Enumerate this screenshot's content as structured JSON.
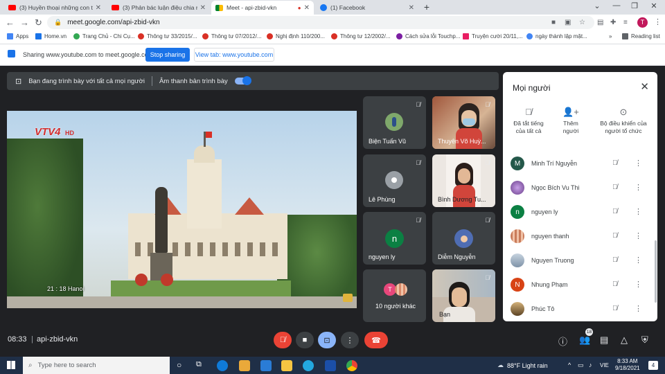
{
  "tabs": [
    {
      "title": "(3) Huyền thoại những con tàu k",
      "icon": "youtube-icon"
    },
    {
      "title": "(3) Phản bác luận điệu chia r",
      "icon": "youtube-icon"
    },
    {
      "title": "Meet - api-zbid-vkn",
      "icon": "meet-icon"
    },
    {
      "title": "(1) Facebook",
      "icon": "facebook-icon"
    }
  ],
  "address": {
    "url": "meet.google.com/api-zbid-vkn"
  },
  "profile_initial": "T",
  "bookmarks": [
    {
      "label": "Apps",
      "color": "#4285f4"
    },
    {
      "label": "Home.vn",
      "color": "#1a73e8"
    },
    {
      "label": "Trang Chủ - Chi Cụ...",
      "color": "#34a853"
    },
    {
      "label": "Thông tư 33/2015/...",
      "color": "#d93025"
    },
    {
      "label": "Thông tư 07/2012/...",
      "color": "#d93025"
    },
    {
      "label": "Nghị định 110/200...",
      "color": "#d93025"
    },
    {
      "label": "Thông tư 12/2002/...",
      "color": "#d93025"
    },
    {
      "label": "Cách sửa lỗi Touchp...",
      "color": "#7b1fa2"
    },
    {
      "label": "Truyện cười 20/11,...",
      "color": "#e91e63"
    },
    {
      "label": "ngày thành lập mặt...",
      "color": "#4285f4"
    },
    {
      "label": "»",
      "color": ""
    },
    {
      "label": "Reading list",
      "color": "#5f6368"
    }
  ],
  "sharing": {
    "text": "Sharing www.youtube.com to meet.google.com",
    "stop_label": "Stop sharing",
    "view_label": "View tab: www.youtube.com"
  },
  "presenting": {
    "text": "Bạn đang trình bày với tất cả mọi người",
    "audio_label": "Âm thanh bản trình bày",
    "audio_on": true
  },
  "video": {
    "channel": "VTV4",
    "hd": "HD",
    "time": "21 : 18 Hanoi"
  },
  "participants": [
    {
      "name": "Biện Tuấn Vũ",
      "avatar": "photo",
      "avatar_color": "#7fa86b",
      "muted": true
    },
    {
      "name": "Thuyên Võ Huỳ...",
      "avatar": "video",
      "muted": true
    },
    {
      "name": "Lê Phùng",
      "avatar": "photo",
      "avatar_color": "#9aa0a6",
      "muted": true
    },
    {
      "name": "Bình Dương Tu...",
      "avatar": "video",
      "muted": true
    },
    {
      "name": "nguyen ly",
      "avatar": "n",
      "avatar_color": "#0b8043",
      "muted": true
    },
    {
      "name": "Diễm Nguyễn",
      "avatar": "photo",
      "avatar_color": "#4f6db3",
      "muted": true
    },
    {
      "name": "10 người khác",
      "avatar": "T",
      "avatar_color": "#e8477b"
    },
    {
      "name": "Bạn",
      "avatar": "video",
      "muted": true
    }
  ],
  "panel": {
    "title": "Mọi người",
    "actions": [
      {
        "label": "Đã tắt tiếng\ncủa tất cả",
        "icon": "mic-off-icon"
      },
      {
        "label": "Thêm\nngười",
        "icon": "add-person-icon"
      },
      {
        "label": "Bộ điều khiển của\nngười tổ chức",
        "icon": "toggle-icon"
      }
    ],
    "people": [
      {
        "name": "Minh Trí Nguyễn",
        "initial": "M",
        "color": "#24584a"
      },
      {
        "name": "Ngọc Bích Vu Thi",
        "initial": "",
        "color": "#6a3e8a"
      },
      {
        "name": "nguyen ly",
        "initial": "n",
        "color": "#0b8043"
      },
      {
        "name": "nguyen thanh",
        "initial": "",
        "color": "#c97b5a"
      },
      {
        "name": "Nguyen Truong",
        "initial": "",
        "color": "#7f93a8"
      },
      {
        "name": "Nhung Phạm",
        "initial": "N",
        "color": "#d84315"
      },
      {
        "name": "Phúc Tô",
        "initial": "",
        "color": "#8a6d3b"
      }
    ]
  },
  "bottom": {
    "time": "08:33",
    "code": "api-zbid-vkn",
    "people_count": "18"
  },
  "taskbar": {
    "search_placeholder": "Type here to search",
    "weather": "88°F  Light rain",
    "lang": "VIE",
    "time": "8:33 AM",
    "date": "9/18/2021",
    "notifications": "4"
  }
}
